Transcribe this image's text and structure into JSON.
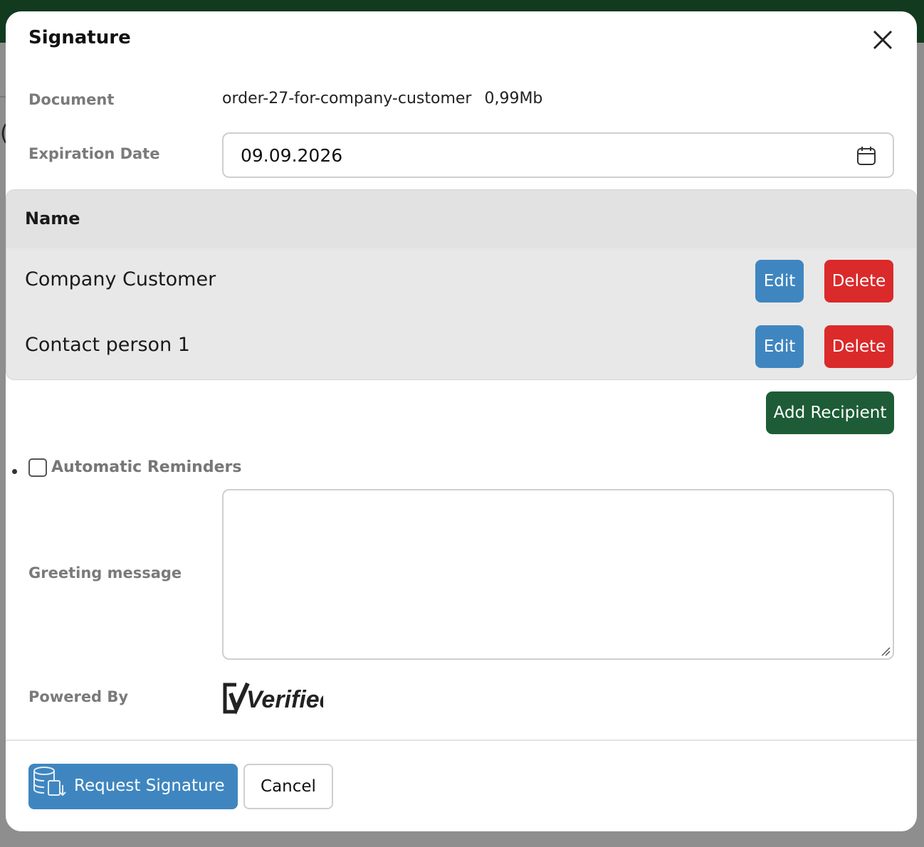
{
  "modal": {
    "title": "Signature",
    "document_label": "Document",
    "document_name": "order-27-for-company-customer",
    "document_size": "0,99Mb",
    "expiration_label": "Expiration Date",
    "expiration_value": "09.09.2026"
  },
  "recipients": {
    "header_name": "Name",
    "rows": [
      {
        "name": "Company Customer",
        "edit_label": "Edit",
        "delete_label": "Delete"
      },
      {
        "name": "Contact person 1",
        "edit_label": "Edit",
        "delete_label": "Delete"
      }
    ],
    "add_label": "Add Recipient"
  },
  "reminders": {
    "label": "Automatic Reminders",
    "checked": false
  },
  "greeting": {
    "label": "Greeting message",
    "value": ""
  },
  "powered": {
    "label": "Powered By",
    "logo_text": "Verified"
  },
  "footer": {
    "request_label": "Request Signature",
    "cancel_label": "Cancel"
  },
  "icons": {
    "close": "close-icon",
    "calendar": "calendar-icon",
    "request": "database-download-icon",
    "resize": "resize-grip-icon"
  },
  "colors": {
    "topbar": "#113a1f",
    "primary": "#3f86c0",
    "danger": "#da2a2a",
    "success": "#1d5c36"
  }
}
